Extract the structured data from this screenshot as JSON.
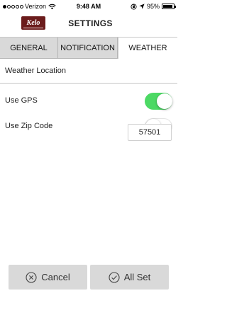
{
  "status_bar": {
    "carrier": "Verizon",
    "time": "9:48 AM",
    "battery": "95%",
    "battery_level": 0.95,
    "signal_bars_filled": 1,
    "signal_bars_total": 5
  },
  "header": {
    "logo_text": "Kelo",
    "title": "SETTINGS"
  },
  "tabs": [
    {
      "label": "GENERAL",
      "active": false
    },
    {
      "label": "NOTIFICATION",
      "active": false
    },
    {
      "label": "WEATHER",
      "active": true
    }
  ],
  "weather": {
    "section_title": "Weather Location",
    "use_gps": {
      "label": "Use GPS",
      "on": true
    },
    "use_zip": {
      "label": "Use Zip Code",
      "on": false
    },
    "zip_value": "57501"
  },
  "buttons": {
    "cancel": "Cancel",
    "ok": "All Set"
  },
  "colors": {
    "toggle_on": "#4cd964",
    "tab_bg": "#d9d9d9",
    "logo_bg": "#6b1c1c"
  }
}
